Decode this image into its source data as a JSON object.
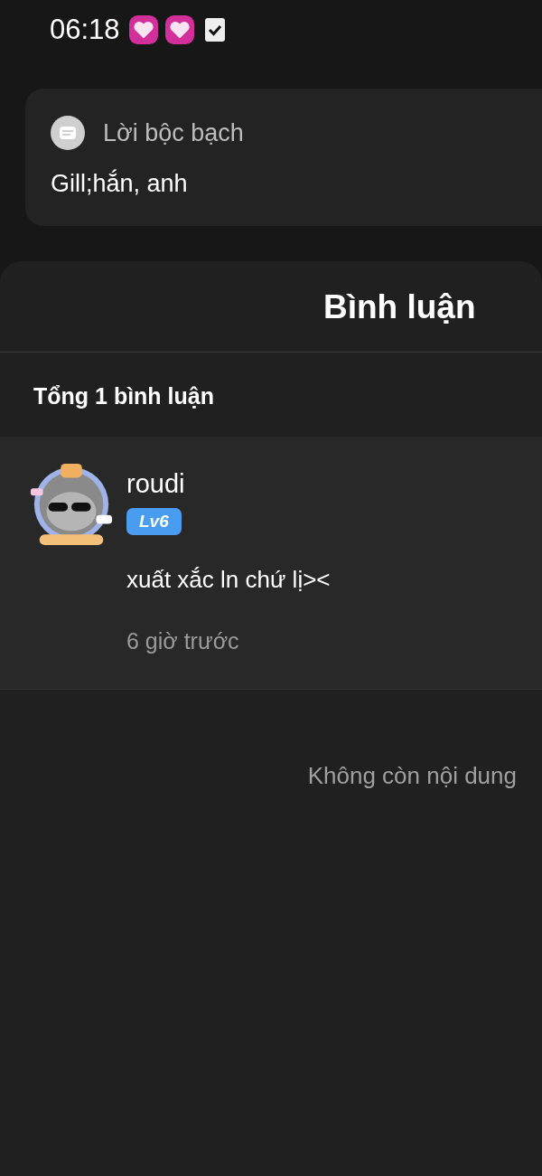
{
  "status_bar": {
    "time": "06:18"
  },
  "notification": {
    "title": "Lời bộc bạch",
    "body": "Gill;hắn, anh"
  },
  "sheet": {
    "title": "Bình luận",
    "count_label": "Tổng 1 bình luận",
    "comments": [
      {
        "user": "roudi",
        "level": "Lv6",
        "text": "xuất xắc ln chứ lị><",
        "time": "6 giờ trước"
      }
    ],
    "end_label": "Không còn nội dung"
  }
}
